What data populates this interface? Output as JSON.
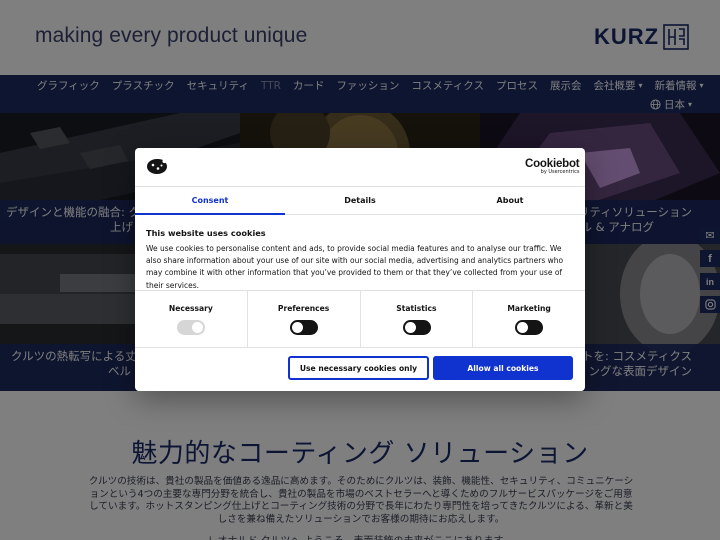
{
  "header": {
    "tagline": "making every product unique",
    "logo_text": "KURZ"
  },
  "nav": {
    "items": [
      {
        "label": "グラフィック",
        "has_dropdown": false
      },
      {
        "label": "プラスチック",
        "has_dropdown": false
      },
      {
        "label": "セキュリティ",
        "has_dropdown": false
      },
      {
        "label": "TTR",
        "has_dropdown": false
      },
      {
        "label": "カード",
        "has_dropdown": false
      },
      {
        "label": "ファッション",
        "has_dropdown": false
      },
      {
        "label": "コスメティクス",
        "has_dropdown": false
      },
      {
        "label": "プロセス",
        "has_dropdown": false
      },
      {
        "label": "展示会",
        "has_dropdown": false
      },
      {
        "label": "会社概要",
        "has_dropdown": true
      },
      {
        "label": "新着情報",
        "has_dropdown": true
      }
    ],
    "language": "日本"
  },
  "hero": {
    "tiles": [
      {
        "caption_line1": "デザインと機能の融合: ク",
        "caption_line2": "上げ"
      },
      {
        "caption_line1": "リティソリューション",
        "caption_line2": "ル & アナログ"
      },
      {
        "caption_line1": "クルツの熱転写による丈夫",
        "caption_line2": "ベル"
      },
      {
        "caption_line1": "トを: コスメティクス",
        "caption_line2": "ングな表面デザイン"
      }
    ]
  },
  "content": {
    "title": "魅力的なコーティング ソリューション",
    "body": "クルツの技術は、貴社の製品を価値ある逸品に高めます。そのためにクルツは、装飾、機能性、セキュリティ、コミュニケーションという4つの主要な専門分野を統合し、貴社の製品を市場のベストセラーへと導くためのフルサービスパッケージをご用意しています。ホットスタンピング仕上げとコーティング技術の分野で長年にわたり専門性を培ってきたクルツによる、革新と美しさを兼ね備えたソリューションでお客様の期待にお応えします。",
    "more": "レオナルド クルツへ ようこそ。表面装飾の未来がここにあります。"
  },
  "cookie_dialog": {
    "brand_main": "Cookiebot",
    "brand_sub": "by Usercentrics",
    "tabs": [
      {
        "label": "Consent",
        "active": true
      },
      {
        "label": "Details",
        "active": false
      },
      {
        "label": "About",
        "active": false
      }
    ],
    "title": "This website uses cookies",
    "text": "We use cookies to personalise content and ads, to provide social media features and to analyse our traffic. We also share information about your use of our site with our social media, advertising and analytics partners who may combine it with other information that you’ve provided to them or that they’ve collected from your use of their services.",
    "toggles": [
      {
        "label": "Necessary",
        "state": "on",
        "disabled": true
      },
      {
        "label": "Preferences",
        "state": "off",
        "disabled": false
      },
      {
        "label": "Statistics",
        "state": "off",
        "disabled": false
      },
      {
        "label": "Marketing",
        "state": "off",
        "disabled": false
      }
    ],
    "btn_necessary": "Use necessary cookies only",
    "btn_allow": "Allow all cookies",
    "accent_color": "#1032cf"
  },
  "social": [
    "mail-icon",
    "facebook-icon",
    "linkedin-icon",
    "instagram-icon"
  ],
  "colors": {
    "navy": "#1c2a63",
    "accent": "#1032cf"
  }
}
